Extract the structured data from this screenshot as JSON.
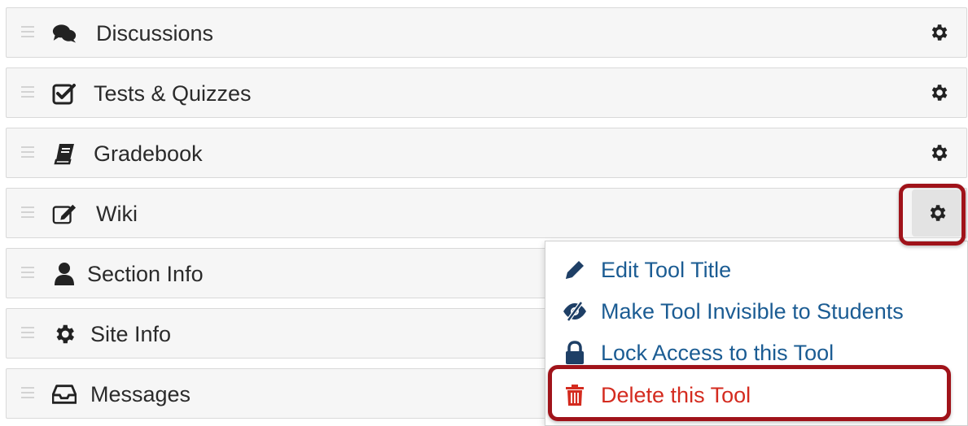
{
  "tools": [
    {
      "label": "Discussions",
      "icon": "comments-icon"
    },
    {
      "label": "Tests & Quizzes",
      "icon": "check-square-icon"
    },
    {
      "label": "Gradebook",
      "icon": "book-icon"
    },
    {
      "label": "Wiki",
      "icon": "edit-icon"
    },
    {
      "label": "Section Info",
      "icon": "user-icon"
    },
    {
      "label": "Site Info",
      "icon": "gear-icon"
    },
    {
      "label": "Messages",
      "icon": "inbox-icon"
    }
  ],
  "menu": {
    "items": [
      {
        "label": "Edit Tool Title",
        "icon": "pencil-icon"
      },
      {
        "label": "Make Tool Invisible to Students",
        "icon": "eye-slash-icon"
      },
      {
        "label": "Lock Access to this Tool",
        "icon": "lock-icon"
      },
      {
        "label": "Delete this Tool",
        "icon": "trash-icon"
      }
    ]
  },
  "colors": {
    "link": "#1b5c93",
    "danger": "#d42b1f",
    "highlight": "#a0131a",
    "icon": "#222222"
  }
}
